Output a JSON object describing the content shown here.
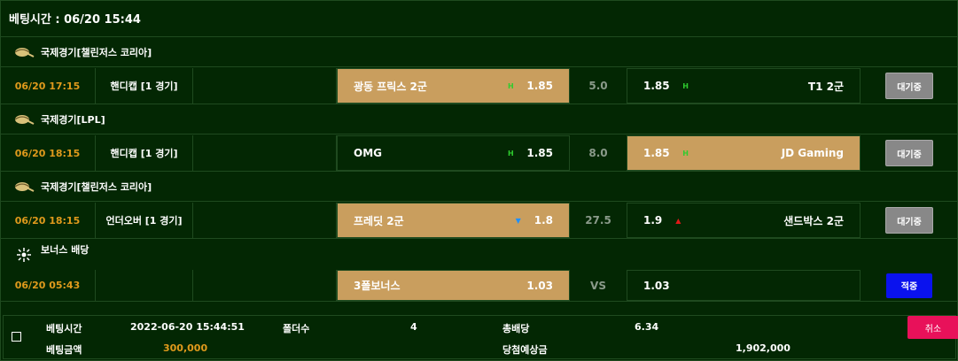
{
  "header": {
    "bet_time_label": "베팅시간 : 06/20 15:44"
  },
  "leagues": [
    {
      "name": "국제경기[챌린저스 코리아]",
      "icon": "globe-icon"
    },
    {
      "name": "국제경기[LPL]",
      "icon": "globe-icon"
    },
    {
      "name": "국제경기[챌린저스 코리아]",
      "icon": "globe-icon"
    },
    {
      "name": "보너스 배당",
      "icon": "bonus-icon"
    }
  ],
  "matches": [
    {
      "time": "06/20 17:15",
      "type": "핸디캡 [1 경기]",
      "home": "광동 프릭스 2군",
      "home_ind": "H",
      "home_odd": "1.85",
      "mid": "5.0",
      "away_odd": "1.85",
      "away_ind": "H",
      "away": "T1 2군",
      "status": "대기중",
      "selected": "home"
    },
    {
      "time": "06/20 18:15",
      "type": "핸디캡 [1 경기]",
      "home": "OMG",
      "home_ind": "H",
      "home_odd": "1.85",
      "mid": "8.0",
      "away_odd": "1.85",
      "away_ind": "H",
      "away": "JD Gaming",
      "status": "대기중",
      "selected": "away"
    },
    {
      "time": "06/20 18:15",
      "type": "언더오버 [1 경기]",
      "home": "프레딧 2군",
      "home_ind": "▼",
      "home_odd": "1.8",
      "mid": "27.5",
      "away_odd": "1.9",
      "away_ind": "▲",
      "away": "샌드박스 2군",
      "status": "대기중",
      "selected": "home"
    },
    {
      "time": "06/20 05:43",
      "type": "",
      "home": "3폴보너스",
      "home_ind": "",
      "home_odd": "1.03",
      "mid": "VS",
      "away_odd": "1.03",
      "away_ind": "",
      "away": "",
      "status": "적중",
      "selected": "home"
    }
  ],
  "summary": {
    "bet_time_label": "베팅시간",
    "bet_time_value": "2022-06-20 15:44:51",
    "folder_label": "폴더수",
    "folder_value": "4",
    "total_odds_label": "총배당",
    "total_odds_value": "6.34",
    "bet_amount_label": "베팅금액",
    "bet_amount_value": "300,000",
    "expected_win_label": "당첨예상금",
    "expected_win_value": "1,902,000",
    "cancel_label": "취소"
  },
  "colors": {
    "time": "#e09a1c",
    "selected_bg": "#c99e5e",
    "indicator_h": "#2ecc2e",
    "indicator_down": "#1e90ff",
    "indicator_up": "#e01818",
    "hit_btn": "#0a12ee",
    "cancel_btn": "#e8115a",
    "amount": "#e09a1c"
  }
}
